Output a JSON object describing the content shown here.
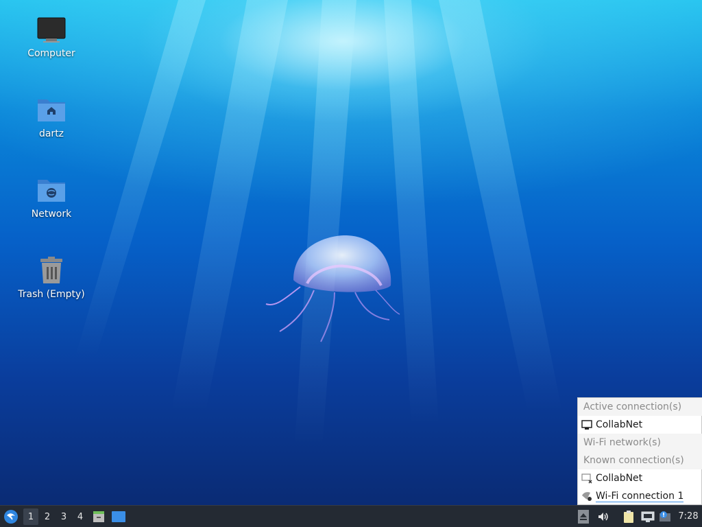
{
  "desktop": {
    "icons": [
      {
        "label": "Computer",
        "icon": "monitor-icon"
      },
      {
        "label": "dartz",
        "icon": "home-folder-icon"
      },
      {
        "label": "Network",
        "icon": "network-folder-icon"
      },
      {
        "label": "Trash (Empty)",
        "icon": "trash-icon"
      }
    ]
  },
  "network_menu": {
    "active_header": "Active connection(s)",
    "active_items": [
      {
        "label": "CollabNet",
        "icon": "wired-network-icon"
      }
    ],
    "wifi_header": "Wi-Fi network(s)",
    "known_header": "Known connection(s)",
    "known_items": [
      {
        "label": "CollabNet",
        "icon": "wired-disconnected-icon"
      },
      {
        "label": "Wi-Fi connection 1",
        "icon": "wifi-disconnected-icon"
      }
    ]
  },
  "taskbar": {
    "workspaces": [
      "1",
      "2",
      "3",
      "4"
    ],
    "active_workspace": "1",
    "clock": "7:28",
    "colors": {
      "panel": "#242a33",
      "accent": "#3a8ee6"
    }
  }
}
